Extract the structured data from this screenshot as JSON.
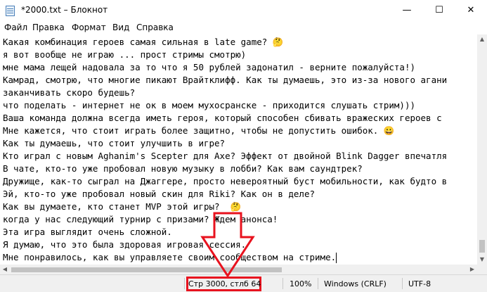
{
  "window": {
    "title": "*2000.txt – Блокнот",
    "minimize_glyph": "—",
    "maximize_glyph": "☐",
    "close_glyph": "✕"
  },
  "menu": {
    "items": [
      "Файл",
      "Правка",
      "Формат",
      "Вид",
      "Справка"
    ]
  },
  "editor": {
    "lines": [
      "Какая комбинация героев самая сильная в late game? 🤔",
      "я вот вообще не играю ... прост стримы смотрю)",
      "мне мама лещей надовала за то что я 50 рублей задонатил - верните пожалуйста!)",
      "Камрад, смотрю, что многие пикают Врайтклифф. Как ты думаешь, это из-за нового агани",
      "заканчивать скоро будешь?",
      "что поделать - интернет не ок в моем мухосранске - приходится слушать стрим)))",
      "Ваша команда должна всегда иметь героя, который способен сбивать вражеских героев с",
      "Мне кажется, что стоит играть более защитно, чтобы не допустить ошибок. 😀",
      "Как ты думаешь, что стоит улучшить в игре?",
      "Кто играл с новым Aghanim's Scepter для Axe? Эффект от двойной Blink Dagger впечатля",
      "В чате, кто-то уже пробовал новую музыку в лобби? Как вам саундтрек?",
      "Дружище, как-то сыграл на Джаггере, просто невероятный буст мобильности, как будто в",
      "Эй, кто-то уже пробовал новый скин для Riki? Как он в деле?",
      "Как вы думаете, кто станет MVP этой игры?  🤔",
      "когда у нас следующий турнир с призами? Ждем анонса!",
      "Эта игра выглядит очень сложной.",
      "Я думаю, что это была здоровая игровая сессия.",
      "Мне понравилось, как вы управляете своим сообществом на стриме."
    ]
  },
  "statusbar": {
    "position": "Стр 3000, стлб 64",
    "zoom": "100%",
    "line_endings": "Windows (CRLF)",
    "encoding": "UTF-8"
  },
  "annotation": {
    "highlight_color": "#e8121e"
  }
}
